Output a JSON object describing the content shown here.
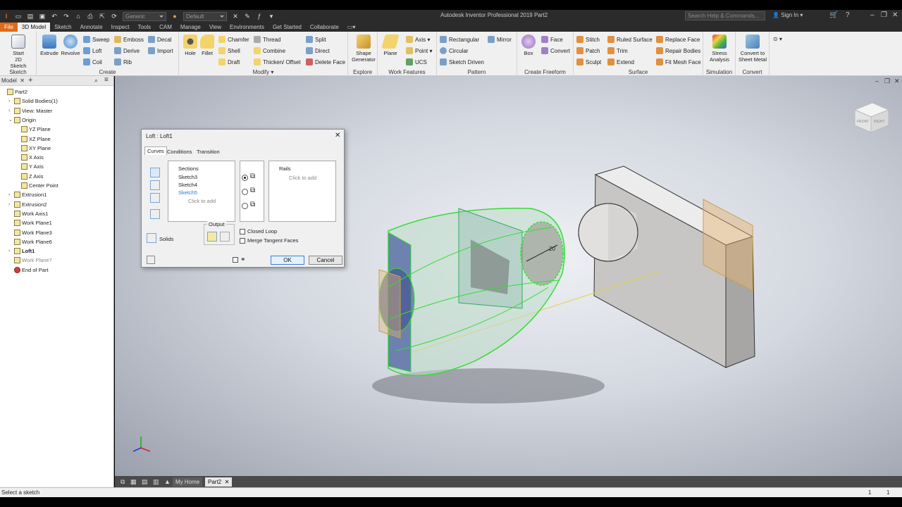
{
  "app": {
    "title": "Autodesk Inventor Professional 2019   Part2",
    "search_placeholder": "Search Help & Commands...",
    "sign_in": "Sign In",
    "material_combo": "Generic",
    "appearance_combo": "Default"
  },
  "menu_tabs": [
    "File",
    "3D Model",
    "Sketch",
    "Annotate",
    "Inspect",
    "Tools",
    "CAM",
    "Manage",
    "View",
    "Environments",
    "Get Started",
    "Collaborate"
  ],
  "ribbon": {
    "sketch": {
      "start_label": "Start",
      "start_label2": "2D Sketch",
      "group": "Sketch"
    },
    "create": {
      "extrude": "Extrude",
      "revolve": "Revolve",
      "sweep": "Sweep",
      "loft": "Loft",
      "coil": "Coil",
      "emboss": "Emboss",
      "derive": "Derive",
      "rib": "Rib",
      "decal": "Decal",
      "import": "Import",
      "group": "Create"
    },
    "modify": {
      "hole": "Hole",
      "fillet": "Fillet",
      "chamfer": "Chamfer",
      "shell": "Shell",
      "draft": "Draft",
      "thread": "Thread",
      "combine": "Combine",
      "thicken": "Thicken/ Offset",
      "split": "Split",
      "direct": "Direct",
      "delete_face": "Delete Face",
      "group": "Modify"
    },
    "explore": {
      "shape": "Shape",
      "generator": "Generator",
      "group": "Explore"
    },
    "work_features": {
      "plane": "Plane",
      "axis": "Axis",
      "point": "Point",
      "ucs": "UCS",
      "group": "Work Features"
    },
    "pattern": {
      "rectangular": "Rectangular",
      "circular": "Circular",
      "sketch_driven": "Sketch Driven",
      "mirror": "Mirror",
      "group": "Pattern"
    },
    "freeform": {
      "box": "Box",
      "face": "Face",
      "convert": "Convert",
      "group": "Create Freeform"
    },
    "surface": {
      "stitch": "Stitch",
      "patch": "Patch",
      "sculpt": "Sculpt",
      "ruled_surface": "Ruled Surface",
      "trim": "Trim",
      "extend": "Extend",
      "replace_face": "Replace Face",
      "repair_bodies": "Repair Bodies",
      "fit_mesh_face": "Fit Mesh Face",
      "group": "Surface"
    },
    "simulation": {
      "stress": "Stress",
      "analysis": "Analysis",
      "group": "Simulation"
    },
    "convert": {
      "convert_to": "Convert to",
      "sheet_metal": "Sheet Metal",
      "group": "Convert"
    }
  },
  "browser": {
    "tab": "Model",
    "nodes": [
      {
        "label": "Part2",
        "level": 0,
        "exp": ""
      },
      {
        "label": "Solid Bodies(1)",
        "level": 1,
        "exp": "›"
      },
      {
        "label": "View: Master",
        "level": 1,
        "exp": "›"
      },
      {
        "label": "Origin",
        "level": 1,
        "exp": "⌄"
      },
      {
        "label": "YZ Plane",
        "level": 2,
        "exp": ""
      },
      {
        "label": "XZ Plane",
        "level": 2,
        "exp": ""
      },
      {
        "label": "XY Plane",
        "level": 2,
        "exp": ""
      },
      {
        "label": "X Axis",
        "level": 2,
        "exp": ""
      },
      {
        "label": "Y Axis",
        "level": 2,
        "exp": ""
      },
      {
        "label": "Z Axis",
        "level": 2,
        "exp": ""
      },
      {
        "label": "Center Point",
        "level": 2,
        "exp": ""
      },
      {
        "label": "Extrusion1",
        "level": 1,
        "exp": "›"
      },
      {
        "label": "Extrusion2",
        "level": 1,
        "exp": "›"
      },
      {
        "label": "Work Axis1",
        "level": 1,
        "exp": ""
      },
      {
        "label": "Work Plane1",
        "level": 1,
        "exp": ""
      },
      {
        "label": "Work Plane3",
        "level": 1,
        "exp": ""
      },
      {
        "label": "Work Plane6",
        "level": 1,
        "exp": ""
      },
      {
        "label": "Loft1",
        "level": 1,
        "exp": "›"
      },
      {
        "label": "Work Plane7",
        "level": 1,
        "exp": ""
      },
      {
        "label": "End of Part",
        "level": 1,
        "exp": ""
      }
    ]
  },
  "dialog": {
    "title": "Loft : Loft1",
    "tabs": [
      "Curves",
      "Conditions",
      "Transition"
    ],
    "sections_header": "Sections",
    "sections": [
      "Sketch3",
      "Sketch4",
      "Sketch5"
    ],
    "click_to_add": "Click to add",
    "rails_header": "Rails",
    "output_label": "Output",
    "solids_label": "Solids",
    "closed_loop": "Closed Loop",
    "merge_tangent": "Merge Tangent Faces",
    "ok": "OK",
    "cancel": "Cancel"
  },
  "viewport": {
    "dimension": "20",
    "viewcube_front": "FRONT",
    "viewcube_right": "RIGHT"
  },
  "doc_tabs": [
    "My Home",
    "Part2"
  ],
  "status": {
    "prompt": "Select a sketch",
    "count1": "1",
    "count2": "1"
  }
}
